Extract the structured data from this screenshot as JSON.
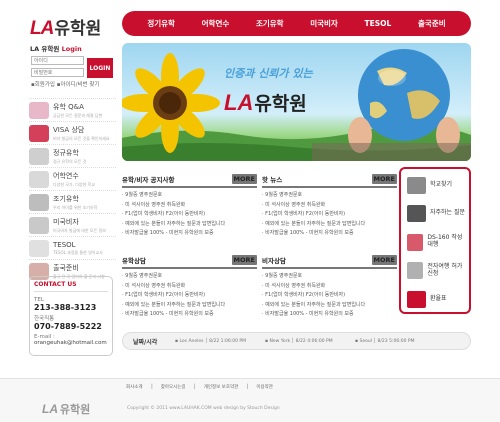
{
  "logo": {
    "la": "LA",
    "ko": "유학원"
  },
  "nav": [
    "정기유학",
    "어학연수",
    "조기유학",
    "미국비자",
    "TESOL",
    "출국준비"
  ],
  "login": {
    "title_prefix": "LA 유학원",
    "title_bold": "Login",
    "id_placeholder": "아이디",
    "pw_placeholder": "비밀번호",
    "button": "LOGIN",
    "links": "▪회원가입  ▪아이디/비번 찾기"
  },
  "sidebar": [
    {
      "title": "유학 Q&A",
      "sub": "궁금한 모든 질문과 해결 답변",
      "color": "#e8b8c8"
    },
    {
      "title": "VISA 상담",
      "sub": "비자 발급의 모든 것을 확인하세요",
      "color": "#d4405a"
    },
    {
      "title": "정규유학",
      "sub": "정규 유학의 모든 것",
      "color": "#cfcfcf"
    },
    {
      "title": "어학연수",
      "sub": "다양한 국가, 다양한 학교",
      "color": "#d9d9d9"
    },
    {
      "title": "조기유학",
      "sub": "우리 아이를 위한 조기유학",
      "color": "#bdbdbd"
    },
    {
      "title": "미국비자",
      "sub": "미국비자 발급에 대한 모든 정보",
      "color": "#c9c9c9"
    },
    {
      "title": "TESOL",
      "sub": "TESOL 과정을 통한 영어교사",
      "color": "#e0e0e0"
    },
    {
      "title": "출국준비",
      "sub": "출국 전 꼭 알아야 할 준비 사항",
      "color": "#d6b0a8"
    }
  ],
  "contact": {
    "title": "CONTACT US",
    "tel_label": "TEL",
    "tel": "213-388-3123",
    "kr_label": "한국직통",
    "kr": "070-7889-5222",
    "email_label": "E-mail :",
    "email": "orangeuhak@hotmail.com"
  },
  "hero": {
    "slogan": "인증과 신뢰가 있는",
    "la": "LA",
    "ko": "유학원"
  },
  "boards": [
    {
      "title": "유학/비자 공지사항",
      "more": "MORE",
      "items": [
        "· 9월중 영주권문호",
        "· 미 석사이상 영주권 취득완화",
        "· F1(업미 학생비자) F2(아이 동반비자)",
        "· 예외에 있는 분들이 자주하는 질문과 답변입니다",
        "· 비자발급율 100% - 미현지 유학원의 보증"
      ]
    },
    {
      "title": "핫 뉴스",
      "more": "MORE",
      "items": [
        "· 9월중 영주권문호",
        "· 미 석사이상 영주권 취득완화",
        "· F1(업미 학생비자) F2(아이 동반비자)",
        "· 예외에 있는 분들이 자주하는 질문과 답변입니다",
        "· 비자발급율 100% - 미현지 유학원의 보증"
      ]
    },
    {
      "title": "유학상담",
      "more": "MORE",
      "items": [
        "· 9월중 영주권문호",
        "· 미 석사이상 영주권 취득완화",
        "· F1(업미 학생비자) F2(아이 동반비자)",
        "· 예외에 있는 분들이 자주하는 질문과 답변입니다",
        "· 비자발급율 100% - 미현지 유학원의 보증"
      ]
    },
    {
      "title": "비자상담",
      "more": "MORE",
      "items": [
        "· 9월중 영주권문호",
        "· 미 석사이상 영주권 취득완화",
        "· F1(업미 학생비자) F2(아이 동반비자)",
        "· 예외에 있는 분들이 자주하는 질문과 답변입니다",
        "· 비자발급율 100% - 미현지 유학원의 보증"
      ]
    }
  ],
  "quick": [
    {
      "label": "학교찾기",
      "icon": "school-icon",
      "color": "#8a8a8a"
    },
    {
      "label": "자주하는 질문",
      "icon": "faq-icon",
      "color": "#555"
    },
    {
      "label": "DS-160 작성대행",
      "icon": "document-icon",
      "color": "#d85a6a"
    },
    {
      "label": "전자여행 허가신청",
      "icon": "passport-icon",
      "color": "#b0b0b0"
    },
    {
      "label": "환율표",
      "icon": "chart-icon",
      "color": "#c8102e"
    }
  ],
  "worldtime": {
    "label": "날짜/시각",
    "cities": [
      {
        "name": "Los Aneles",
        "time": "8/22 1:06:00 PM"
      },
      {
        "name": "New York",
        "time": "8/22 4:06:00 PM"
      },
      {
        "name": "Seoul",
        "time": "8/23 5:06:00 PM"
      }
    ]
  },
  "footer": {
    "links": [
      "회사소개",
      "찾아오시는길",
      "개인정보 보호약관",
      "이용약관"
    ],
    "copyright": "Copyright © 2011  www.LAUHAK.COM   web design by Stouch Design",
    "la": "LA",
    "ko": "유학원"
  }
}
